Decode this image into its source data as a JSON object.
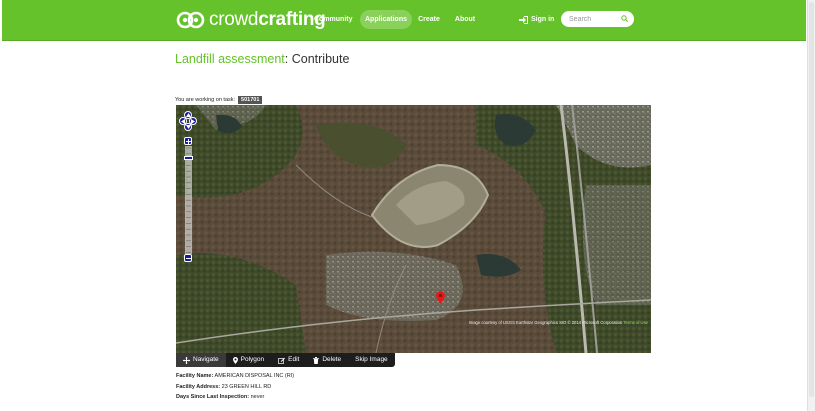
{
  "navbar": {
    "brand_light": "crowd",
    "brand_bold": "crafting",
    "items": [
      {
        "label": "Community",
        "active": false
      },
      {
        "label": "Applications",
        "active": true
      },
      {
        "label": "Create",
        "active": false
      },
      {
        "label": "About",
        "active": false
      }
    ],
    "signin_label": "Sign in",
    "search_placeholder": "Search",
    "color": "#65c22a"
  },
  "page": {
    "app_name": "Landfill assessment",
    "title_suffix": ": Contribute"
  },
  "task": {
    "label": "You are working on task:",
    "id": "501701"
  },
  "map": {
    "attribution": "Image courtesy of USGS Earthstar Geographics SIO © 2014 Microsoft Corporation",
    "terms_label": "Terms of Use",
    "marker_color": "#e01b1b",
    "zoom_level_fraction": 0.9
  },
  "toolbar": {
    "items": [
      {
        "label": "Navigate",
        "icon": "move-icon",
        "active": true
      },
      {
        "label": "Polygon",
        "icon": "map-pin-icon",
        "active": false
      },
      {
        "label": "Edit",
        "icon": "edit-icon",
        "active": false
      },
      {
        "label": "Delete",
        "icon": "trash-icon",
        "active": false
      },
      {
        "label": "Skip Image",
        "icon": "",
        "active": false
      }
    ]
  },
  "facility": {
    "name_label": "Facility Name:",
    "name_value": "AMERICAN DISPOSAL INC (RI)",
    "address_label": "Facility Address:",
    "address_value": "23 GREEN HILL RD",
    "days_label": "Days Since Last Inspection:",
    "days_value": "never"
  }
}
